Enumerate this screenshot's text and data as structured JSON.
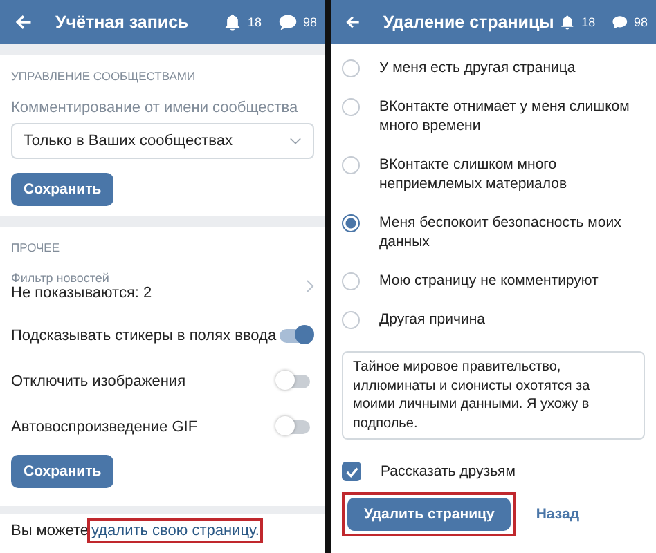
{
  "left": {
    "header": {
      "title": "Учётная запись",
      "notifications": "18",
      "messages": "98"
    },
    "communities": {
      "heading": "УПРАВЛЕНИЕ СООБЩЕСТВАМИ",
      "label": "Комментирование от имени сообщества",
      "dropdown_value": "Только в Ваших сообществах",
      "button": "Сохранить"
    },
    "other": {
      "heading": "ПРОЧЕЕ",
      "filter_label": "Фильтр новостей",
      "filter_value": "Не показываются: 2",
      "toggles": [
        {
          "label": "Подсказывать стикеры в полях ввода",
          "on": true
        },
        {
          "label": "Отключить изображения",
          "on": false
        },
        {
          "label": "Автовоспроизведение GIF",
          "on": false
        }
      ],
      "button": "Сохранить"
    },
    "footer": {
      "text": "Вы можете",
      "link": "удалить свою страницу.",
      "highlighted": true
    }
  },
  "right": {
    "header": {
      "title": "Удаление страницы",
      "notifications": "18",
      "messages": "98"
    },
    "reasons": [
      {
        "label": "У меня есть другая страница",
        "selected": false
      },
      {
        "label": "ВКонтакте отнимает у меня слишком много времени",
        "selected": false
      },
      {
        "label": "ВКонтакте слишком много неприемлемых материалов",
        "selected": false
      },
      {
        "label": "Меня беспокоит безопасность моих данных",
        "selected": true
      },
      {
        "label": "Мою страницу не комментируют",
        "selected": false
      },
      {
        "label": "Другая причина",
        "selected": false
      }
    ],
    "comment": "Тайное мировое правительство, иллюминаты и сионисты охотятся за моими личными данными. Я ухожу в подполье.",
    "tell_friends": {
      "label": "Рассказать друзьям",
      "checked": true
    },
    "delete_button": {
      "label": "Удалить страницу",
      "highlighted": true
    },
    "back_link": "Назад"
  }
}
